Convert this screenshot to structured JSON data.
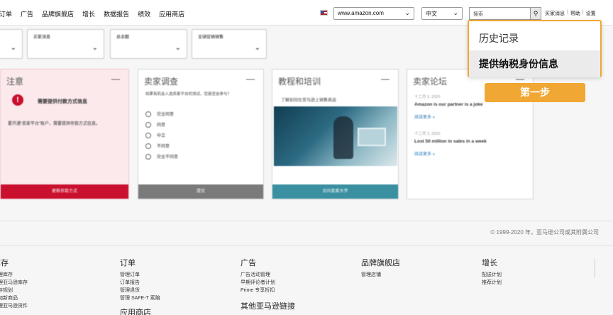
{
  "nav": {
    "items": [
      "订单",
      "广告",
      "品牌旗舰店",
      "增长",
      "数据报告",
      "绩效",
      "应用商店"
    ],
    "marketplace": "www.amazon.com",
    "language": "中文",
    "search_placeholder": "搜索",
    "links": [
      "买家消息",
      "帮助",
      "设置"
    ]
  },
  "filters": [
    {
      "label": ""
    },
    {
      "label": "买家消息"
    },
    {
      "label": "总余额"
    },
    {
      "label": "全球促销销售"
    }
  ],
  "cards": {
    "notice": {
      "title": "注意",
      "heading": "需要提供付款方式信息",
      "body": "要开通“卖家平台”账户，需要提供存款方式信息。",
      "button": "更新存款方式"
    },
    "survey": {
      "title": "卖家调查",
      "desc": "如果有机会入选卖家平台的测试，您是否会参与？",
      "options": [
        "完全同意",
        "同意",
        "中立",
        "不同意",
        "完全不同意"
      ],
      "button": "提交"
    },
    "education": {
      "title": "教程和培训",
      "caption": "了解如何在亚马逊上销售商品",
      "button": "访问卖家大学"
    },
    "forum": {
      "title": "卖家论坛",
      "posts": [
        {
          "date": "十二月 3, 2020",
          "title": "Amazon is our partner is a joke",
          "more": "阅读更多 »"
        },
        {
          "date": "十二月 3, 2020",
          "title": "Lost 50 million in sales in a week",
          "more": "阅读更多 »"
        }
      ]
    }
  },
  "footer": {
    "copyright": "© 1999-2020 年，亚马逊公司或其附属公司",
    "columns": [
      {
        "heading": "库存",
        "items": [
          "管理库存",
          "管理亚马逊库存",
          "库存规划",
          "添加新商品",
          "管理亚马逊货件",
          "..."
        ]
      },
      {
        "heading": "订单",
        "items": [
          "管理订单",
          "订单报告",
          "管理退货",
          "管理 SAFE-T 索赔"
        ],
        "extra_heading": "应用商店"
      },
      {
        "heading": "广告",
        "items": [
          "广告活动管理",
          "早期评论者计划",
          "Prime 专享折扣"
        ],
        "extra_heading": "其他亚马逊链接"
      },
      {
        "heading": "品牌旗舰店",
        "items": [
          "管理店铺"
        ]
      },
      {
        "heading": "增长",
        "items": [
          "配送计划",
          "推荐计划"
        ]
      }
    ]
  },
  "dropdown": {
    "items": [
      "历史记录",
      "提供纳税身份信息"
    ]
  },
  "step_badge": "第一步",
  "colors": {
    "accent": "#f0a733",
    "notice_red": "#c9102e",
    "survey_bar": "#7a7a7a",
    "edu_bar": "#3a8fa0",
    "notice_bar": "#c9102e"
  }
}
